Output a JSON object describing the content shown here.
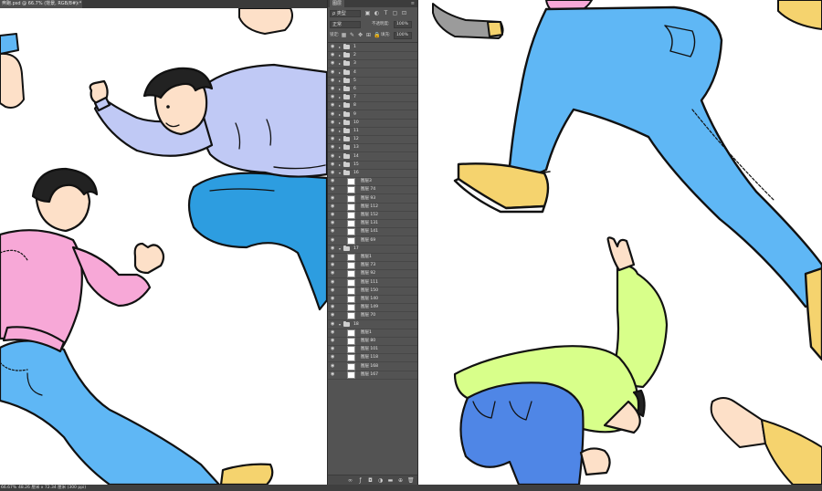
{
  "document": {
    "tab_title": "奔跑.psd @ 66.7% (背景, RGB/8#) *",
    "tab_close": "×"
  },
  "panel": {
    "title": "图层",
    "menu_icon": "menu-icon",
    "kind_filter": "ρ 类型",
    "blend_mode": "正常",
    "opacity_label": "不透明度:",
    "opacity_value": "100%",
    "lock_label": "锁定:",
    "fill_label": "填充:",
    "fill_value": "100%"
  },
  "layers": [
    {
      "type": "group",
      "name": "1",
      "open": false
    },
    {
      "type": "group",
      "name": "2",
      "open": false
    },
    {
      "type": "group",
      "name": "3",
      "open": false
    },
    {
      "type": "group",
      "name": "4",
      "open": false
    },
    {
      "type": "group",
      "name": "5",
      "open": false
    },
    {
      "type": "group",
      "name": "6",
      "open": false
    },
    {
      "type": "group",
      "name": "7",
      "open": false
    },
    {
      "type": "group",
      "name": "8",
      "open": false
    },
    {
      "type": "group",
      "name": "9",
      "open": false
    },
    {
      "type": "group",
      "name": "10",
      "open": false
    },
    {
      "type": "group",
      "name": "11",
      "open": false
    },
    {
      "type": "group",
      "name": "12",
      "open": false
    },
    {
      "type": "group",
      "name": "13",
      "open": false
    },
    {
      "type": "group",
      "name": "14",
      "open": false
    },
    {
      "type": "group",
      "name": "15",
      "open": false
    },
    {
      "type": "group",
      "name": "16",
      "open": true
    },
    {
      "type": "layer",
      "name": "图层3"
    },
    {
      "type": "layer",
      "name": "图层 74"
    },
    {
      "type": "layer",
      "name": "图层 93"
    },
    {
      "type": "layer",
      "name": "图层 112"
    },
    {
      "type": "layer",
      "name": "图层 152"
    },
    {
      "type": "layer",
      "name": "图层 131"
    },
    {
      "type": "layer",
      "name": "图层 141"
    },
    {
      "type": "layer",
      "name": "图层 69"
    },
    {
      "type": "group",
      "name": "17",
      "open": true
    },
    {
      "type": "layer",
      "name": "图层1"
    },
    {
      "type": "layer",
      "name": "图层 73"
    },
    {
      "type": "layer",
      "name": "图层 92"
    },
    {
      "type": "layer",
      "name": "图层 111"
    },
    {
      "type": "layer",
      "name": "图层 150"
    },
    {
      "type": "layer",
      "name": "图层 140"
    },
    {
      "type": "layer",
      "name": "图层 149"
    },
    {
      "type": "layer",
      "name": "图层 70"
    },
    {
      "type": "group",
      "name": "18",
      "open": true
    },
    {
      "type": "layer",
      "name": "图层1"
    },
    {
      "type": "layer",
      "name": "图层 80"
    },
    {
      "type": "layer",
      "name": "图层 101"
    },
    {
      "type": "layer",
      "name": "图层 118"
    },
    {
      "type": "layer",
      "name": "图层 168"
    },
    {
      "type": "layer",
      "name": "图层 167"
    }
  ],
  "footer_icons": [
    "link-icon",
    "fx-icon",
    "mask-icon",
    "adjustment-icon",
    "new-group-icon",
    "new-layer-icon",
    "trash-icon"
  ],
  "status": {
    "zoom": "66.67%",
    "info": "48.26 厘米 x 72.34 厘米 (300 ppi)"
  },
  "colors": {
    "hoodie_blue": "#c0c9f5",
    "jeans_blue": "#5fb7f5",
    "hoodie_pink": "#f7a8d7",
    "hoodie_green": "#d8ff8a",
    "jeans_dark": "#4f86e6",
    "shoe_yellow": "#f5d36e",
    "skin": "#fde0c8"
  }
}
